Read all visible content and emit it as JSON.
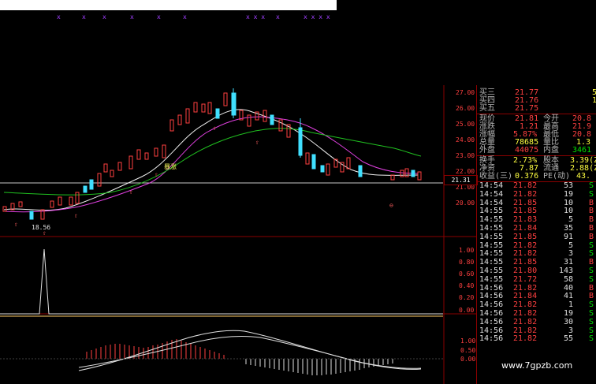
{
  "watermark": "www.7gpzb.com",
  "current_price_marker": "21.31",
  "chart_annotations": {
    "low_marker": "18.56",
    "label_baozhang": "暴涨"
  },
  "price_axis_ticks": [
    "27.00",
    "26.00",
    "25.00",
    "24.00",
    "23.00",
    "22.00",
    "21.00",
    "20.00"
  ],
  "indicator_axis_ticks": [
    "1.00",
    "0.80",
    "0.60",
    "0.40",
    "0.20",
    "0.00"
  ],
  "indicator2_axis_ticks": [
    "1.00",
    "0.50",
    "0.00"
  ],
  "quote": {
    "rows": [
      {
        "label": "买三",
        "value": "21.77",
        "extra": "5"
      },
      {
        "label": "买四",
        "value": "21.76",
        "extra": "1"
      },
      {
        "label": "买五",
        "value": "21.75",
        "extra": ""
      },
      {
        "label": "现价",
        "value": "21.81",
        "label2": "今开",
        "value2": "20.8"
      },
      {
        "label": "涨跌",
        "value": "1.21",
        "label2": "最高",
        "value2": "21.9"
      },
      {
        "label": "涨幅",
        "value": "5.87%",
        "label2": "最低",
        "value2": "20.8"
      },
      {
        "label": "总量",
        "value": "78685",
        "label2": "量比",
        "value2": "1.3"
      },
      {
        "label": "外盘",
        "value": "44075",
        "label2": "内盘",
        "value2": "3461"
      },
      {
        "label": "换手",
        "value": "2.73%",
        "label2": "股本",
        "value2": "3.39(Z"
      },
      {
        "label": "净资",
        "value": "7.87",
        "label2": "流通",
        "value2": "2.88(Z"
      },
      {
        "label": "收益(三)",
        "value": "0.376",
        "label2": "PE(动)",
        "value2": "43."
      }
    ]
  },
  "ticks": [
    {
      "time": "14:54",
      "price": "21.82",
      "vol": "53",
      "dir": "S"
    },
    {
      "time": "14:54",
      "price": "21.82",
      "vol": "19",
      "dir": "S"
    },
    {
      "time": "14:54",
      "price": "21.85",
      "vol": "10",
      "dir": "B"
    },
    {
      "time": "14:55",
      "price": "21.85",
      "vol": "10",
      "dir": "B"
    },
    {
      "time": "14:55",
      "price": "21.83",
      "vol": "5",
      "dir": "B"
    },
    {
      "time": "14:55",
      "price": "21.84",
      "vol": "35",
      "dir": "B"
    },
    {
      "time": "14:55",
      "price": "21.85",
      "vol": "91",
      "dir": "B"
    },
    {
      "time": "14:55",
      "price": "21.82",
      "vol": "5",
      "dir": "S"
    },
    {
      "time": "14:55",
      "price": "21.82",
      "vol": "3",
      "dir": "S"
    },
    {
      "time": "14:55",
      "price": "21.85",
      "vol": "31",
      "dir": "B"
    },
    {
      "time": "14:55",
      "price": "21.80",
      "vol": "143",
      "dir": "S"
    },
    {
      "time": "14:55",
      "price": "21.72",
      "vol": "58",
      "dir": "S"
    },
    {
      "time": "14:56",
      "price": "21.82",
      "vol": "40",
      "dir": "B"
    },
    {
      "time": "14:56",
      "price": "21.84",
      "vol": "41",
      "dir": "B"
    },
    {
      "time": "14:56",
      "price": "21.82",
      "vol": "1",
      "dir": "S"
    },
    {
      "time": "14:56",
      "price": "21.82",
      "vol": "19",
      "dir": "S"
    },
    {
      "time": "14:56",
      "price": "21.82",
      "vol": "30",
      "dir": "S"
    },
    {
      "time": "14:56",
      "price": "21.82",
      "vol": "3",
      "dir": "S"
    },
    {
      "time": "14:56",
      "price": "21.82",
      "vol": "55",
      "dir": "S"
    }
  ]
}
